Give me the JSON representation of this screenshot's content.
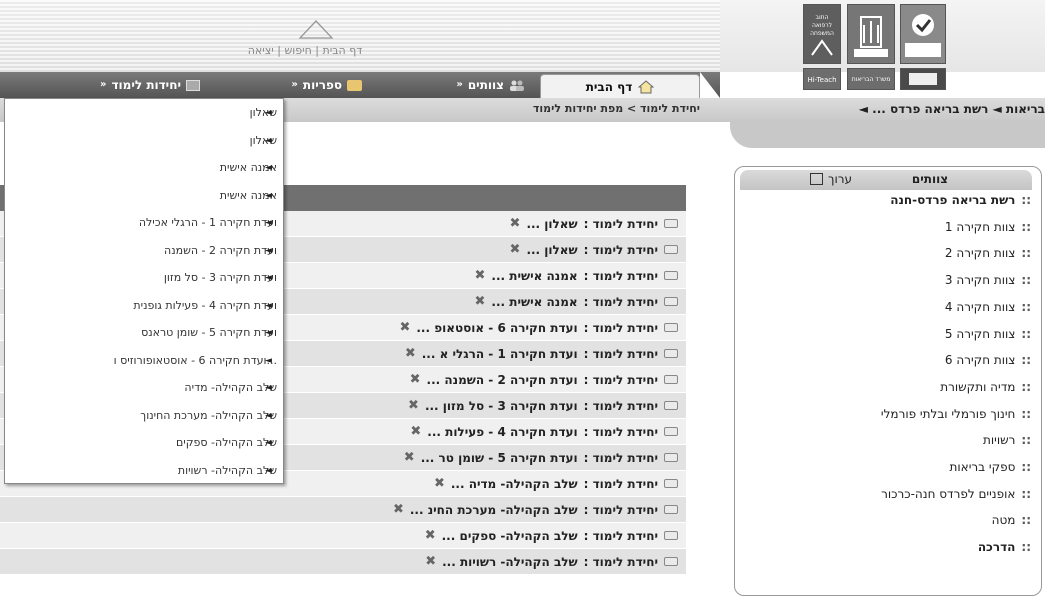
{
  "top_links": {
    "home": "דף הבית",
    "search": "חיפוש",
    "exit": "יציאה",
    "sep": " | "
  },
  "logos": {
    "hi_teach": "Hi-Teach",
    "ministry": "משרד הבריאות",
    "health": "התוב לרפואה המשפחה"
  },
  "nav": {
    "home": "דף הבית",
    "teams": "צוותים",
    "libraries": "ספריות",
    "units": "יחידות לימוד",
    "chevron": "«"
  },
  "breadcrumb": {
    "current": "יחידת לימוד > מפת יחידות לימוד",
    "trail": "בריאות ◄ רשת בריאה פרדס ... ◄"
  },
  "dropdown_items": [
    "שאלון",
    "שאלון",
    "אמנה אישית",
    "אמנה אישית",
    "ועדת חקירה 1 - הרגלי אכילה",
    "ועדת חקירה 2 - השמנה",
    "ועדת חקירה 3 - סל מזון",
    "ועדת חקירה 4 - פעילות גופנית",
    "ועדת חקירה 5 - שומן טראנס",
    "...ועדת חקירה 6 - אוסטאופורוזיס ו",
    "שלב הקהילה- מדיה",
    "שלב הקהילה- מערכת החינוך",
    "שלב הקהילה- ספקים",
    "שלב הקהילה- רשויות"
  ],
  "dropdown_arrow": "◄",
  "unit_label": "יחידת לימוד :",
  "rows": [
    "שאלון ...",
    "שאלון ...",
    "אמנה אישית ...",
    "אמנה אישית ...",
    "ועדת חקירה 6 - אוסטאופ ...",
    "ועדת חקירה 1 - הרגלי א ...",
    "ועדת חקירה 2 - השמנה ...",
    "ועדת חקירה 3 - סל מזון ...",
    "ועדת חקירה 4 - פעילות ...",
    "ועדת חקירה 5 - שומן טר ...",
    "שלב הקהילה- מדיה ...",
    "שלב הקהילה- מערכת החינ ...",
    "שלב הקהילה- ספקים ...",
    "שלב הקהילה- רשויות ..."
  ],
  "teams": {
    "title": "צוותים",
    "edit": "ערוך",
    "bullet": "::",
    "items": [
      {
        "label": "רשת בריאה פרדס-חנה",
        "bold": true
      },
      {
        "label": "צוות חקירה 1"
      },
      {
        "label": "צוות חקירה 2"
      },
      {
        "label": "צוות חקירה 3"
      },
      {
        "label": "צוות חקירה 4"
      },
      {
        "label": "צוות חקירה 5"
      },
      {
        "label": "צוות חקירה 6"
      },
      {
        "label": "מדיה ותקשורת"
      },
      {
        "label": "חינוך פורמלי ובלתי פורמלי"
      },
      {
        "label": "רשויות"
      },
      {
        "label": "ספקי בריאות"
      },
      {
        "label": "אופניים לפרדס חנה-כרכור"
      },
      {
        "label": "מטה"
      },
      {
        "label": "הדרכה",
        "bold": true
      }
    ]
  },
  "icons": {
    "units": "book-icon",
    "libraries": "folder-icon",
    "teams": "people-icon",
    "home": "house-icon",
    "row": "envelope-icon",
    "row_tool": "wrench-icon",
    "edit": "edit-icon"
  }
}
